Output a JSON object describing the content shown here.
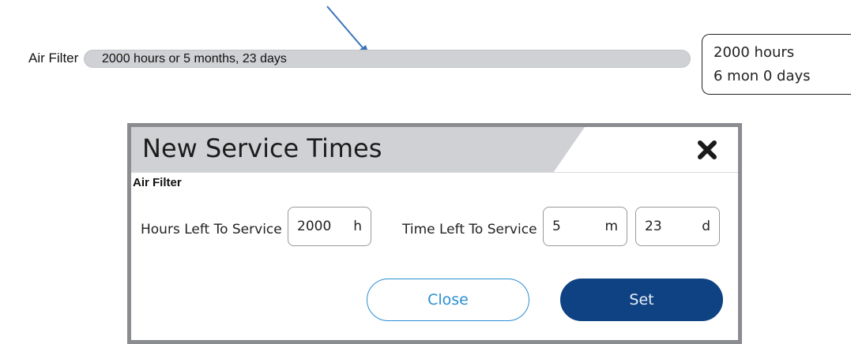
{
  "status_row": {
    "label": "Air Filter",
    "progress_text": "2000 hours or 5 months, 23 days",
    "summary_hours": "2000 hours",
    "summary_time": "6 mon 0 days"
  },
  "dialog": {
    "title": "New Service Times",
    "close_icon": "close-x-icon",
    "section": "Air Filter",
    "hours_label": "Hours Left To Service",
    "hours_value": "2000",
    "hours_unit": "h",
    "time_label": "Time Left To Service",
    "months_value": "5",
    "months_unit": "m",
    "days_value": "23",
    "days_unit": "d",
    "close_button": "Close",
    "set_button": "Set"
  },
  "colors": {
    "progress_track": "#cfd1d4",
    "header_bg": "#cfd1d4",
    "set_button": "#0e4283",
    "close_button_border": "#2a8fd0",
    "annotation_arrow": "#3b73b9"
  }
}
